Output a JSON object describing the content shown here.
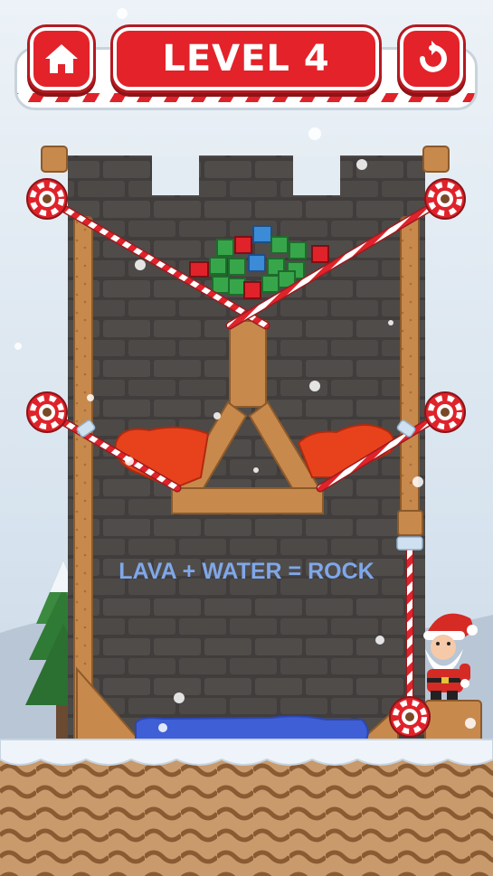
{
  "header": {
    "level_label": "LEVEL 4",
    "home_icon": "home-icon",
    "restart_icon": "restart-icon"
  },
  "hint": {
    "text": "LAVA + WATER = ROCK"
  },
  "pins": [
    {
      "name": "top-left-pin",
      "pulled": false
    },
    {
      "name": "top-right-pin",
      "pulled": false
    },
    {
      "name": "middle-left-pin",
      "pulled": false
    },
    {
      "name": "middle-right-pin",
      "pulled": false
    },
    {
      "name": "vertical-right-pin",
      "pulled": false
    }
  ],
  "items": {
    "gifts": "pile of gift boxes",
    "lava": "lava pools",
    "water": "water pool",
    "character": "santa"
  },
  "colors": {
    "accent_red": "#e3222a",
    "lava": "#e8421c",
    "water": "#3f5fd6",
    "wood": "#c8894c",
    "wall": "#4a4745",
    "hint_text": "#7fa7ea"
  }
}
